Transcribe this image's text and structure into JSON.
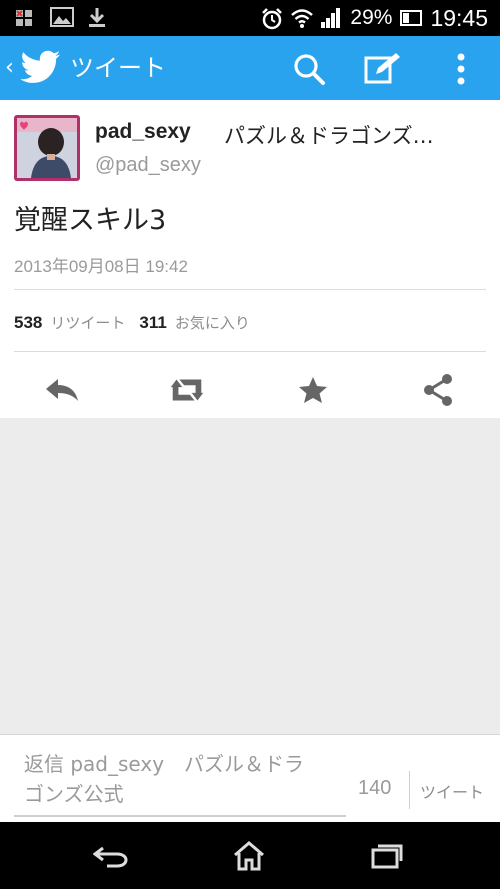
{
  "status_bar": {
    "battery_percent": "29%",
    "time": "19:45",
    "icons": [
      "notification-icon",
      "image-icon",
      "download-icon",
      "alarm-icon",
      "wifi-icon",
      "signal-icon",
      "battery-icon"
    ]
  },
  "action_bar": {
    "back_glyph": "‹",
    "title": "ツイート",
    "color": "#2aa3ef",
    "buttons": [
      "search-icon",
      "compose-icon",
      "more-icon"
    ]
  },
  "tweet": {
    "display_name": "pad_sexy",
    "full_name": "パズル＆ドラゴンズ…",
    "handle": "@pad_sexy",
    "text": "覚醒スキル3",
    "timestamp": "2013年09月08日 19:42",
    "retweet_count": "538",
    "retweet_label": "リツイート",
    "favorite_count": "311",
    "favorite_label": "お気に入り",
    "actions": [
      "reply-icon",
      "retweet-icon",
      "favorite-icon",
      "share-icon"
    ]
  },
  "compose": {
    "placeholder_line1": "返信 pad_sexy　パズル＆ドラ",
    "placeholder_line2": "ゴンズ公式",
    "char_count": "140",
    "tweet_button": "ツイート"
  },
  "nav_bar": {
    "buttons": [
      "back-icon",
      "home-icon",
      "recent-apps-icon"
    ]
  }
}
